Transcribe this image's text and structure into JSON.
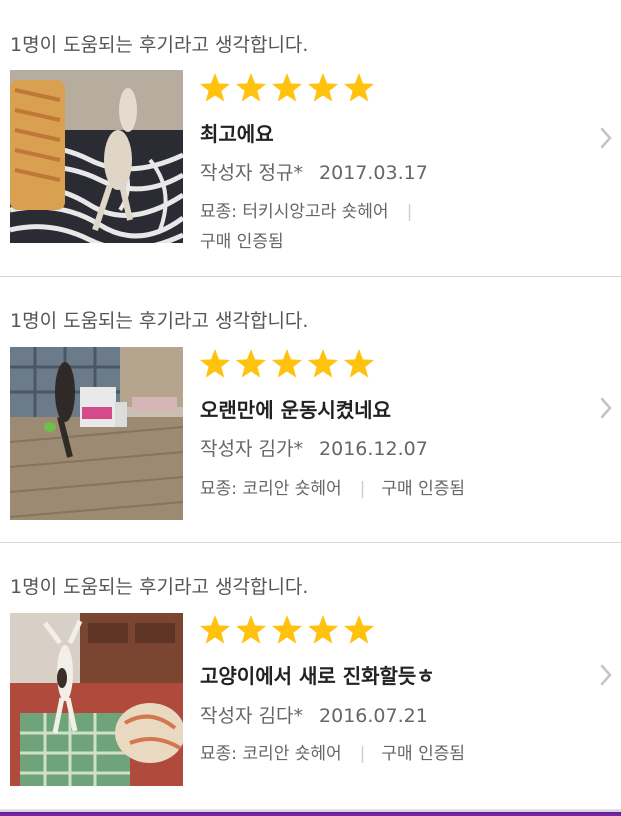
{
  "colors": {
    "star": "#ffc20e",
    "accent_bar": "#7b2aa8",
    "text_primary": "#222222",
    "text_secondary": "#666666"
  },
  "reviews": [
    {
      "helpful_text": "1명이 도움되는 후기라고 생각합니다.",
      "rating": 5,
      "rating_max": 5,
      "title": "최고에요",
      "author_label": "작성자",
      "author": "정규*",
      "date": "2017.03.17",
      "breed": "묘종: 터키시앙고라 숏헤어",
      "separator": "|",
      "verified": "구매 인증됨",
      "thumbnail_icon": "cat-photo"
    },
    {
      "helpful_text": "1명이 도움되는 후기라고 생각합니다.",
      "rating": 5,
      "rating_max": 5,
      "title": "오랜만에 운동시켰네요",
      "author_label": "작성자",
      "author": "김가*",
      "date": "2016.12.07",
      "breed": "묘종: 코리안 숏헤어",
      "separator": "|",
      "verified": "구매 인증됨",
      "thumbnail_icon": "cat-photo"
    },
    {
      "helpful_text": "1명이 도움되는 후기라고 생각합니다.",
      "rating": 5,
      "rating_max": 5,
      "title": "고양이에서 새로 진화할듯ㅎ",
      "author_label": "작성자",
      "author": "김다*",
      "date": "2016.07.21",
      "breed": "묘종: 코리안 숏헤어",
      "separator": "|",
      "verified": "구매 인증됨",
      "thumbnail_icon": "cat-photo"
    }
  ]
}
